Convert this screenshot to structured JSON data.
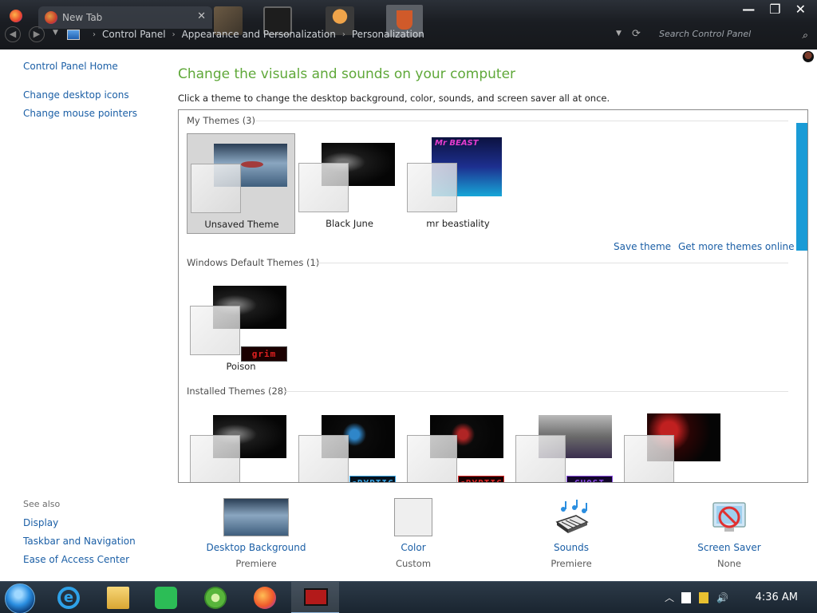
{
  "browser": {
    "tab_title": "New Tab",
    "close_glyph": "✕"
  },
  "window_controls": {
    "minimize": "—",
    "restore": "❐",
    "close": "✕"
  },
  "breadcrumb": [
    "Control Panel",
    "Appearance and Personalization",
    "Personalization"
  ],
  "search": {
    "placeholder": "Search Control Panel"
  },
  "sidebar": {
    "links": [
      "Control Panel Home",
      "Change desktop icons",
      "Change mouse pointers"
    ],
    "see_also_label": "See also",
    "see_also": [
      "Display",
      "Taskbar and Navigation",
      "Ease of Access Center"
    ]
  },
  "main": {
    "title": "Change the visuals and sounds on your computer",
    "subtitle": "Click a theme to change the desktop background, color, sounds, and screen saver all at once.",
    "actions": {
      "save_theme": "Save theme",
      "get_more": "Get more themes online"
    }
  },
  "themes": {
    "my_themes": {
      "header": "My Themes (3)",
      "items": [
        {
          "name": "Unsaved Theme",
          "selected": true
        },
        {
          "name": "Black June"
        },
        {
          "name": "mr beastiality"
        }
      ]
    },
    "windows_default": {
      "header": "Windows Default Themes (1)",
      "items": [
        {
          "name": "Poison",
          "badge": "grim"
        }
      ]
    },
    "installed": {
      "header": "Installed Themes (28)",
      "badges": [
        "cRYPTIC",
        "cRYPTIC",
        "GHOST"
      ]
    }
  },
  "settings": [
    {
      "label": "Desktop Background",
      "value": "Premiere"
    },
    {
      "label": "Color",
      "value": "Custom"
    },
    {
      "label": "Sounds",
      "value": "Premiere"
    },
    {
      "label": "Screen Saver",
      "value": "None"
    }
  ],
  "taskbar": {
    "clock": "4:36 AM",
    "tray_up": "︿"
  },
  "colors": {
    "accent_green": "#5fa839",
    "link_blue": "#1b5fa6",
    "scroll_blue": "#1a9bd6"
  }
}
